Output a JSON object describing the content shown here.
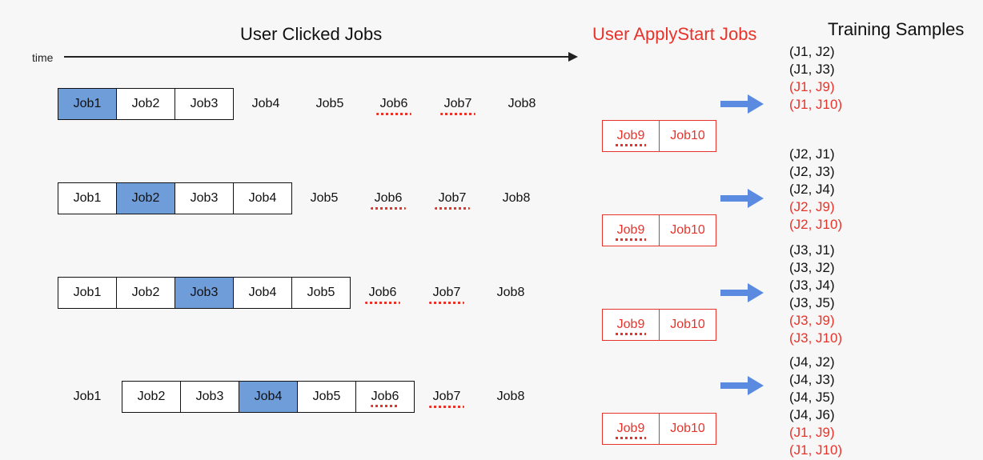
{
  "titles": {
    "clicked": "User Clicked Jobs",
    "apply": "User ApplyStart Jobs",
    "samples": "Training Samples",
    "time": "time"
  },
  "rows": [
    {
      "focus": "Job1",
      "clicked": [
        {
          "label": "Job1",
          "boxed": true,
          "focus": true
        },
        {
          "label": "Job2",
          "boxed": true
        },
        {
          "label": "Job3",
          "boxed": true
        },
        {
          "label": "Job4",
          "boxed": false
        },
        {
          "label": "Job5",
          "boxed": false
        },
        {
          "label": "Job6",
          "boxed": false,
          "squiggle": true
        },
        {
          "label": "Job7",
          "boxed": false,
          "squiggle": true
        },
        {
          "label": "Job8",
          "boxed": false
        }
      ],
      "apply": [
        {
          "label": "Job9",
          "squiggle": true
        },
        {
          "label": "Job10"
        }
      ],
      "samples": [
        {
          "text": "(J1, J2)"
        },
        {
          "text": "(J1, J3)"
        },
        {
          "text": "(J1, J9)",
          "red": true
        },
        {
          "text": "(J1, J10)",
          "red": true
        }
      ]
    },
    {
      "focus": "Job2",
      "clicked": [
        {
          "label": "Job1",
          "boxed": true
        },
        {
          "label": "Job2",
          "boxed": true,
          "focus": true
        },
        {
          "label": "Job3",
          "boxed": true
        },
        {
          "label": "Job4",
          "boxed": true
        },
        {
          "label": "Job5",
          "boxed": false
        },
        {
          "label": "Job6",
          "boxed": false,
          "squiggle": true
        },
        {
          "label": "Job7",
          "boxed": false,
          "squiggle": true
        },
        {
          "label": "Job8",
          "boxed": false
        }
      ],
      "apply": [
        {
          "label": "Job9",
          "squiggle": true
        },
        {
          "label": "Job10"
        }
      ],
      "samples": [
        {
          "text": "(J2, J1)"
        },
        {
          "text": "(J2, J3)"
        },
        {
          "text": "(J2, J4)"
        },
        {
          "text": "(J2, J9)",
          "red": true
        },
        {
          "text": "(J2, J10)",
          "red": true
        }
      ]
    },
    {
      "focus": "Job3",
      "clicked": [
        {
          "label": "Job1",
          "boxed": true
        },
        {
          "label": "Job2",
          "boxed": true
        },
        {
          "label": "Job3",
          "boxed": true,
          "focus": true
        },
        {
          "label": "Job4",
          "boxed": true
        },
        {
          "label": "Job5",
          "boxed": true
        },
        {
          "label": "Job6",
          "boxed": false,
          "squiggle": true
        },
        {
          "label": "Job7",
          "boxed": false,
          "squiggle": true
        },
        {
          "label": "Job8",
          "boxed": false
        }
      ],
      "apply": [
        {
          "label": "Job9",
          "squiggle": true
        },
        {
          "label": "Job10"
        }
      ],
      "samples": [
        {
          "text": "(J3, J1)"
        },
        {
          "text": "(J3, J2)"
        },
        {
          "text": "(J3, J4)"
        },
        {
          "text": "(J3, J5)"
        },
        {
          "text": "(J3, J9)",
          "red": true
        },
        {
          "text": "(J3, J10)",
          "red": true
        }
      ]
    },
    {
      "focus": "Job4",
      "lead_plain": "Job1",
      "clicked": [
        {
          "label": "Job2",
          "boxed": true
        },
        {
          "label": "Job3",
          "boxed": true
        },
        {
          "label": "Job4",
          "boxed": true,
          "focus": true
        },
        {
          "label": "Job5",
          "boxed": true
        },
        {
          "label": "Job6",
          "boxed": true,
          "squiggle": true
        },
        {
          "label": "Job7",
          "boxed": false,
          "squiggle": true
        },
        {
          "label": "Job8",
          "boxed": false
        }
      ],
      "apply": [
        {
          "label": "Job9",
          "squiggle": true
        },
        {
          "label": "Job10"
        }
      ],
      "samples": [
        {
          "text": "(J4, J2)"
        },
        {
          "text": "(J4, J3)"
        },
        {
          "text": "(J4, J5)"
        },
        {
          "text": "(J4, J6)"
        },
        {
          "text": "(J1, J9)",
          "red": true
        },
        {
          "text": "(J1, J10)",
          "red": true
        }
      ]
    }
  ]
}
